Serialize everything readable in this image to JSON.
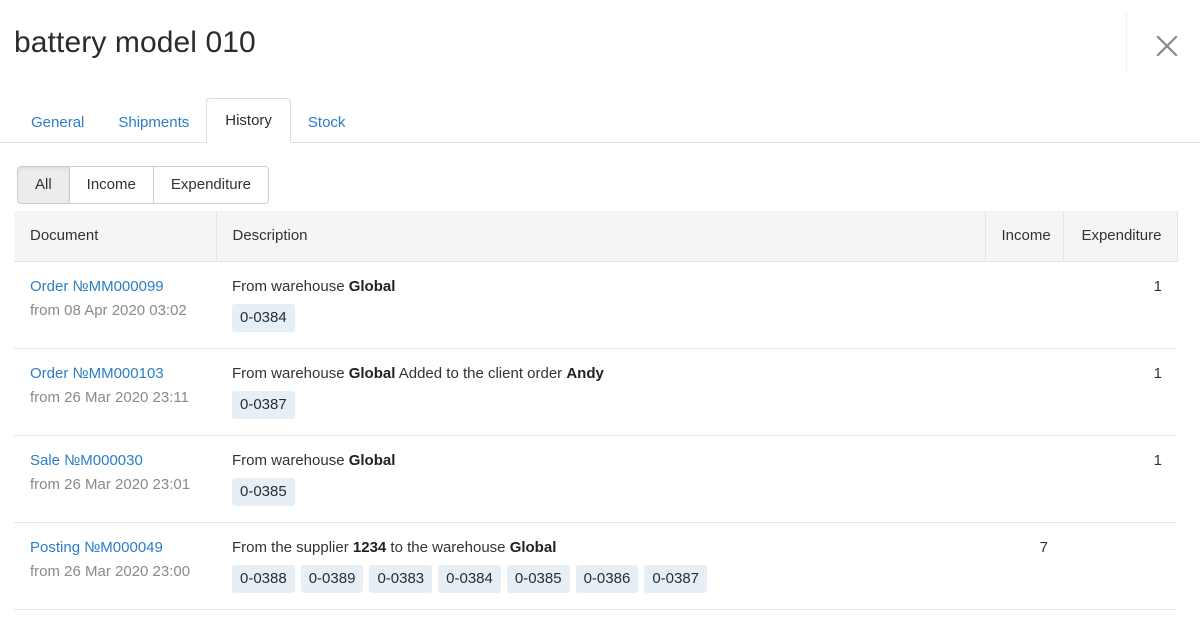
{
  "header": {
    "title": "battery model 010",
    "close_label": "×",
    "close_icon": "close-icon"
  },
  "tabs": [
    {
      "label": "General",
      "active": false
    },
    {
      "label": "Shipments",
      "active": false
    },
    {
      "label": "History",
      "active": true
    },
    {
      "label": "Stock",
      "active": false
    }
  ],
  "filters": [
    {
      "label": "All",
      "active": true
    },
    {
      "label": "Income",
      "active": false
    },
    {
      "label": "Expenditure",
      "active": false
    }
  ],
  "table": {
    "columns": [
      "Document",
      "Description",
      "Income",
      "Expenditure"
    ],
    "rows": [
      {
        "document_link": "Order №MM000099",
        "document_date": "from 08 Apr 2020 03:02",
        "description_html": "From warehouse <b>Global</b>",
        "badges": [
          "0-0384"
        ],
        "income": "",
        "expenditure": "1"
      },
      {
        "document_link": "Order №MM000103",
        "document_date": "from 26 Mar 2020 23:11",
        "description_html": "From warehouse <b>Global</b> Added to the client order <b>Andy</b>",
        "badges": [
          "0-0387"
        ],
        "income": "",
        "expenditure": "1"
      },
      {
        "document_link": "Sale №M000030",
        "document_date": "from 26 Mar 2020 23:01",
        "description_html": "From warehouse <b>Global</b>",
        "badges": [
          "0-0385"
        ],
        "income": "",
        "expenditure": "1"
      },
      {
        "document_link": "Posting №M000049",
        "document_date": "from 26 Mar 2020 23:00",
        "description_html": "From the supplier <b>1234</b> to the warehouse <b>Global</b>",
        "badges": [
          "0-0388",
          "0-0389",
          "0-0383",
          "0-0384",
          "0-0385",
          "0-0386",
          "0-0387"
        ],
        "income": "7",
        "expenditure": ""
      }
    ]
  },
  "colors": {
    "link": "#2b7ec7",
    "badge_bg": "#e6eef6",
    "header_bg": "#f5f5f5",
    "border": "#dddddd",
    "muted_text": "#8a8a8a"
  }
}
